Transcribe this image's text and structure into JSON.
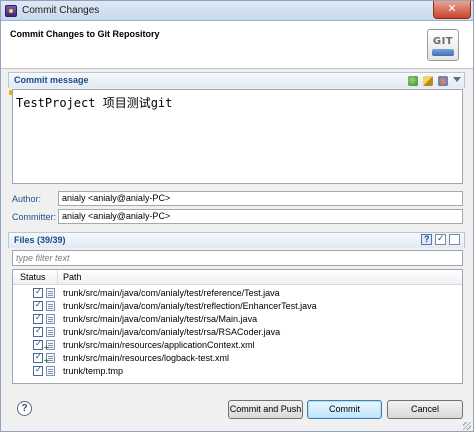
{
  "window": {
    "title": "Commit Changes",
    "close_label": "✕"
  },
  "header": {
    "title": "Commit Changes to Git Repository",
    "logo_text": "GIT"
  },
  "commit_message": {
    "section_title": "Commit message",
    "text": "TestProject 项目测试git",
    "toolbar_icons": [
      "spell-check-icon",
      "format-icon",
      "history-icon",
      "menu-chevron-icon"
    ]
  },
  "author": {
    "label": "Author:",
    "value": "anialy <anialy@anialy-PC>"
  },
  "committer": {
    "label": "Committer:",
    "value": "anialy <anialy@anialy-PC>"
  },
  "files": {
    "section_title": "Files (39/39)",
    "filter_placeholder": "type filter text",
    "columns": {
      "status": "Status",
      "path": "Path"
    },
    "rows": [
      {
        "path": "trunk/src/main/java/com/anialy/test/reference/Test.java",
        "checked": true,
        "status": "modified"
      },
      {
        "path": "trunk/src/main/java/com/anialy/test/reflection/EnhancerTest.java",
        "checked": true,
        "status": "modified"
      },
      {
        "path": "trunk/src/main/java/com/anialy/test/rsa/Main.java",
        "checked": true,
        "status": "modified"
      },
      {
        "path": "trunk/src/main/java/com/anialy/test/rsa/RSACoder.java",
        "checked": true,
        "status": "modified"
      },
      {
        "path": "trunk/src/main/resources/applicationContext.xml",
        "checked": true,
        "status": "added"
      },
      {
        "path": "trunk/src/main/resources/logback-test.xml",
        "checked": true,
        "status": "added"
      },
      {
        "path": "trunk/temp.tmp",
        "checked": true,
        "status": "modified"
      }
    ]
  },
  "buttons": {
    "help": "?",
    "commit_and_push": "Commit and Push",
    "commit": "Commit",
    "cancel": "Cancel"
  }
}
